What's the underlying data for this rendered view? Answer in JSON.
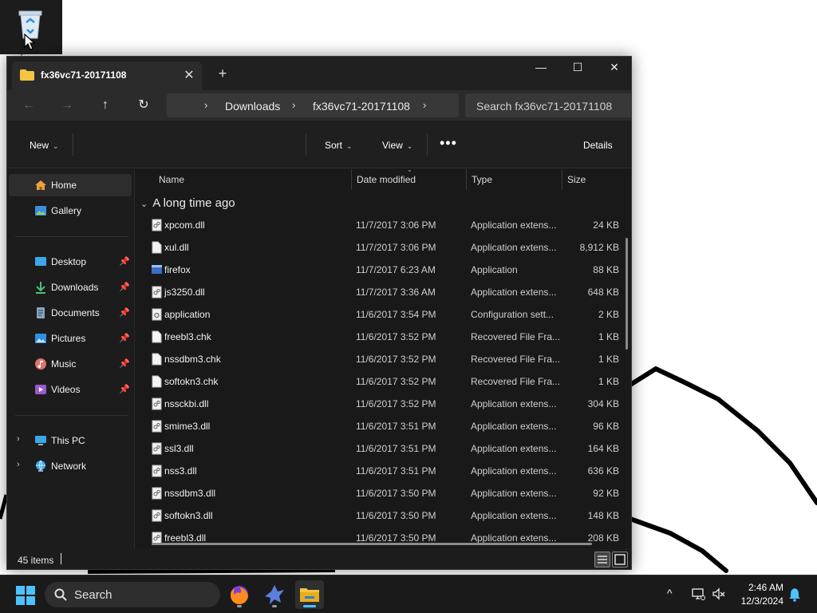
{
  "desktop": {
    "recycle_bin_label": "Recycle Bin"
  },
  "window": {
    "tab_title": "fx36vc71-20171108",
    "new_tab": "+",
    "controls": {
      "minimize": "—",
      "maximize": "☐",
      "close": "✕"
    },
    "nav": {
      "back": "←",
      "forward": "→",
      "up": "↑",
      "refresh": "↻"
    },
    "breadcrumb": [
      "Downloads",
      "fx36vc71-20171108"
    ],
    "search_placeholder": "Search fx36vc71-20171108",
    "commands": {
      "new": "New",
      "sort": "Sort",
      "view": "View",
      "more": "•••",
      "details": "Details"
    },
    "sidebar": {
      "top": [
        {
          "label": "Home",
          "icon": "home-icon",
          "active": true
        },
        {
          "label": "Gallery",
          "icon": "gallery-icon"
        }
      ],
      "pinned": [
        {
          "label": "Desktop",
          "icon": "desktop-icon"
        },
        {
          "label": "Downloads",
          "icon": "downloads-icon"
        },
        {
          "label": "Documents",
          "icon": "documents-icon"
        },
        {
          "label": "Pictures",
          "icon": "pictures-icon"
        },
        {
          "label": "Music",
          "icon": "music-icon"
        },
        {
          "label": "Videos",
          "icon": "videos-icon"
        }
      ],
      "locations": [
        {
          "label": "This PC",
          "icon": "pc-icon"
        },
        {
          "label": "Network",
          "icon": "network-icon"
        }
      ]
    },
    "columns": {
      "name": "Name",
      "date": "Date modified",
      "type": "Type",
      "size": "Size"
    },
    "group_label": "A long time ago",
    "files": [
      {
        "name": "xpcom.dll",
        "date": "11/7/2017 3:06 PM",
        "type": "Application extens...",
        "size": "24 KB",
        "icon": "dll"
      },
      {
        "name": "xul.dll",
        "date": "11/7/2017 3:06 PM",
        "type": "Application extens...",
        "size": "8,912 KB",
        "icon": "blank"
      },
      {
        "name": "firefox",
        "date": "11/7/2017 6:23 AM",
        "type": "Application",
        "size": "88 KB",
        "icon": "app"
      },
      {
        "name": "js3250.dll",
        "date": "11/7/2017 3:36 AM",
        "type": "Application extens...",
        "size": "648 KB",
        "icon": "dll"
      },
      {
        "name": "application",
        "date": "11/6/2017 3:54 PM",
        "type": "Configuration sett...",
        "size": "2 KB",
        "icon": "config"
      },
      {
        "name": "freebl3.chk",
        "date": "11/6/2017 3:52 PM",
        "type": "Recovered File Fra...",
        "size": "1 KB",
        "icon": "blank"
      },
      {
        "name": "nssdbm3.chk",
        "date": "11/6/2017 3:52 PM",
        "type": "Recovered File Fra...",
        "size": "1 KB",
        "icon": "blank"
      },
      {
        "name": "softokn3.chk",
        "date": "11/6/2017 3:52 PM",
        "type": "Recovered File Fra...",
        "size": "1 KB",
        "icon": "blank"
      },
      {
        "name": "nssckbi.dll",
        "date": "11/6/2017 3:52 PM",
        "type": "Application extens...",
        "size": "304 KB",
        "icon": "dll"
      },
      {
        "name": "smime3.dll",
        "date": "11/6/2017 3:51 PM",
        "type": "Application extens...",
        "size": "96 KB",
        "icon": "dll"
      },
      {
        "name": "ssl3.dll",
        "date": "11/6/2017 3:51 PM",
        "type": "Application extens...",
        "size": "164 KB",
        "icon": "dll"
      },
      {
        "name": "nss3.dll",
        "date": "11/6/2017 3:51 PM",
        "type": "Application extens...",
        "size": "636 KB",
        "icon": "dll"
      },
      {
        "name": "nssdbm3.dll",
        "date": "11/6/2017 3:50 PM",
        "type": "Application extens...",
        "size": "92 KB",
        "icon": "dll"
      },
      {
        "name": "softokn3.dll",
        "date": "11/6/2017 3:50 PM",
        "type": "Application extens...",
        "size": "148 KB",
        "icon": "dll"
      },
      {
        "name": "freebl3.dll",
        "date": "11/6/2017 3:50 PM",
        "type": "Application extens...",
        "size": "208 KB",
        "icon": "dll"
      }
    ],
    "status": {
      "items": "45 items"
    }
  },
  "taskbar": {
    "search_label": "Search",
    "apps": [
      {
        "name": "firefox-app",
        "icon": "firefox-icon"
      },
      {
        "name": "bird-app",
        "icon": "bird-icon"
      },
      {
        "name": "file-explorer-app",
        "icon": "folder-icon",
        "active": true
      }
    ],
    "tray_chevron": "^",
    "time": "2:46 AM",
    "date": "12/3/2024"
  },
  "colors": {
    "window_bg": "#191919",
    "taskbar_bg": "#1a1a1a",
    "accent": "#4cc2ff",
    "folder": "#f4c542"
  }
}
